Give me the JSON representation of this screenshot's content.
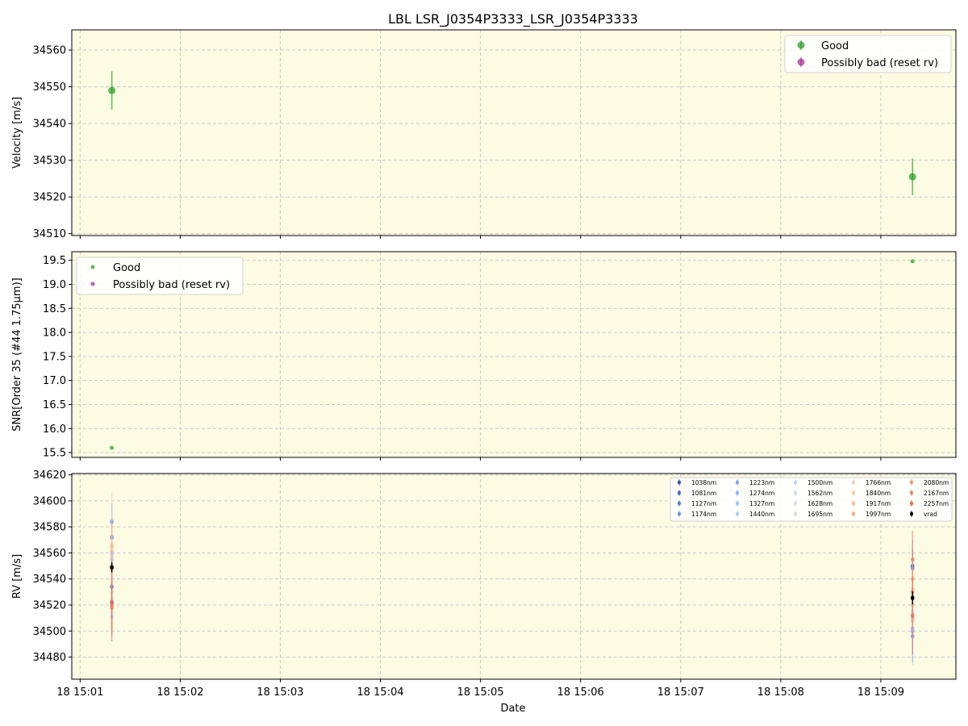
{
  "chart_data": {
    "type": "scatter",
    "title": "LBL LSR_J0354P3333_LSR_J0354P3333",
    "xlabel": "Date",
    "x_ticks": [
      "18 15:01",
      "18 15:02",
      "18 15:03",
      "18 15:04",
      "18 15:05",
      "18 15:06",
      "18 15:07",
      "18 15:08",
      "18 15:09"
    ],
    "background": "#fcfbe3",
    "grid": true,
    "panels": [
      {
        "id": "velocity",
        "ylabel": "Velocity [m/s]",
        "ylim": [
          34509.5,
          34565.5
        ],
        "y_ticks": [
          34510,
          34520,
          34530,
          34540,
          34550,
          34560
        ],
        "legend": {
          "position": "top-right",
          "entries": [
            {
              "label": "Good",
              "color": "#2ca02c"
            },
            {
              "label": "Possibly bad (reset rv)",
              "color": "#a8329a"
            }
          ]
        },
        "series": [
          {
            "name": "Good",
            "color": "#2ca02c",
            "points": [
              {
                "x": "15:01:19",
                "y": 34549,
                "err": 5.2
              },
              {
                "x": "15:09:19",
                "y": 34525.5,
                "err": 5.0
              }
            ]
          },
          {
            "name": "Possibly bad (reset rv)",
            "color": "#a8329a",
            "points": []
          }
        ]
      },
      {
        "id": "snr",
        "ylabel": "SNR[Order 35 (#44 1.75μm)]",
        "ylim": [
          15.4,
          19.68
        ],
        "y_ticks": [
          15.5,
          16.0,
          16.5,
          17.0,
          17.5,
          18.0,
          18.5,
          19.0,
          19.5
        ],
        "legend": {
          "position": "top-left",
          "entries": [
            {
              "label": "Good",
              "color": "#2ca02c"
            },
            {
              "label": "Possibly bad (reset rv)",
              "color": "#a8329a"
            }
          ]
        },
        "series": [
          {
            "name": "Good",
            "color": "#2ca02c",
            "points": [
              {
                "x": "15:01:19",
                "y": 15.6
              },
              {
                "x": "15:09:19",
                "y": 19.48
              }
            ]
          },
          {
            "name": "Possibly bad (reset rv)",
            "color": "#a8329a",
            "points": []
          }
        ]
      },
      {
        "id": "rv",
        "ylabel": "RV [m/s]",
        "ylim": [
          34463,
          34621
        ],
        "y_ticks": [
          34480,
          34500,
          34520,
          34540,
          34560,
          34580,
          34600,
          34620
        ],
        "legend": {
          "position": "top-right",
          "columns": 5
        },
        "series": [
          {
            "name": "1038nm",
            "color": "#3b4cc0",
            "values": [
              34522,
              34550
            ],
            "errs": [
              8,
              12
            ]
          },
          {
            "name": "1081nm",
            "color": "#4a63d3",
            "values": [
              34534,
              34549
            ],
            "errs": [
              10,
              14
            ]
          },
          {
            "name": "1127nm",
            "color": "#5a78e4",
            "values": [
              34572,
              34500
            ],
            "errs": [
              12,
              18
            ]
          },
          {
            "name": "1174nm",
            "color": "#6b8df0",
            "values": [
              34584,
              34496
            ],
            "errs": [
              14,
              20
            ]
          },
          {
            "name": "1223nm",
            "color": "#7b9ff9",
            "values": [
              34521,
              34548
            ],
            "errs": [
              15,
              22
            ]
          },
          {
            "name": "1274nm",
            "color": "#8db0fe",
            "values": [
              34560,
              34502
            ],
            "errs": [
              12,
              20
            ]
          },
          {
            "name": "1327nm",
            "color": "#9ebeff",
            "values": [
              34555,
              34510
            ],
            "errs": [
              10,
              18
            ]
          },
          {
            "name": "1440nm",
            "color": "#aec9fc",
            "values": [
              34511,
              34500
            ],
            "errs": [
              16,
              26
            ]
          },
          {
            "name": "1500nm",
            "color": "#bfd3f6",
            "values": [
              34558,
              34515
            ],
            "errs": [
              10,
              16
            ]
          },
          {
            "name": "1562nm",
            "color": "#cdd9ec",
            "values": [
              34540,
              34520
            ],
            "errs": [
              12,
              18
            ]
          },
          {
            "name": "1628nm",
            "color": "#dadce0",
            "values": [
              34530,
              34525
            ],
            "errs": [
              14,
              20
            ]
          },
          {
            "name": "1695nm",
            "color": "#e5d8d1",
            "values": [
              34525,
              34530
            ],
            "errs": [
              12,
              16
            ]
          },
          {
            "name": "1766nm",
            "color": "#eecfbf",
            "values": [
              34566,
              34532
            ],
            "errs": [
              40,
              20
            ]
          },
          {
            "name": "1840nm",
            "color": "#f4c4ad",
            "values": [
              34562,
              34520
            ],
            "errs": [
              20,
              16
            ]
          },
          {
            "name": "1917nm",
            "color": "#f7b89c",
            "values": [
              34565,
              34508
            ],
            "errs": [
              16,
              14
            ]
          },
          {
            "name": "1997nm",
            "color": "#f7a889",
            "values": [
              34548,
              34540
            ],
            "errs": [
              14,
              18
            ]
          },
          {
            "name": "2080nm",
            "color": "#f39475",
            "values": [
              34520,
              34530
            ],
            "errs": [
              18,
              20
            ]
          },
          {
            "name": "2167nm",
            "color": "#ec7f63",
            "values": [
              34518,
              34555
            ],
            "errs": [
              20,
              22
            ]
          },
          {
            "name": "2257nm",
            "color": "#e26952",
            "values": [
              34522,
              34512
            ],
            "errs": [
              30,
              30
            ]
          },
          {
            "name": "vrad",
            "color": "#000000",
            "values": [
              34549,
              34525.5
            ],
            "errs": [
              4,
              5
            ]
          }
        ],
        "x": [
          "15:01:19",
          "15:09:19"
        ]
      }
    ]
  }
}
